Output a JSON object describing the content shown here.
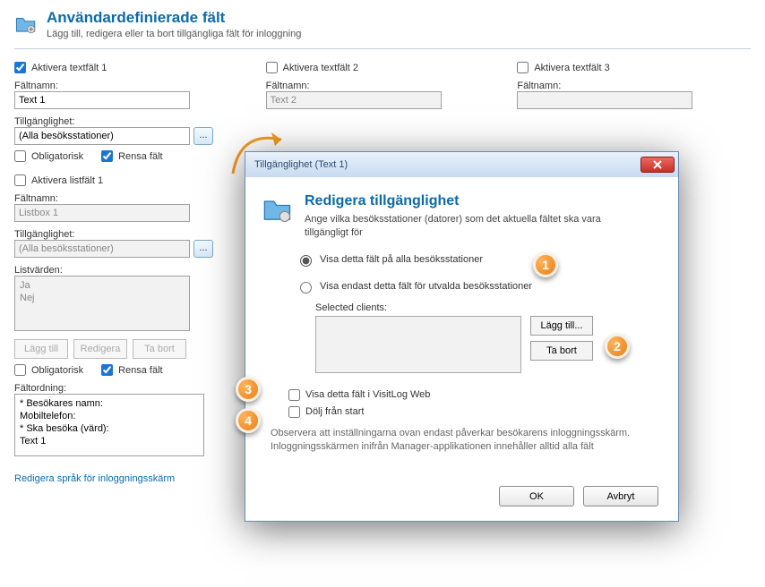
{
  "header": {
    "title": "Användardefinierade fält",
    "subtitle": "Lägg till, redigera eller ta bort tillgängliga fält för inloggning"
  },
  "textfields": [
    {
      "activate_label": "Aktivera textfält 1",
      "activate_checked": true,
      "name_label": "Fältnamn:",
      "name_value": "Text 1",
      "avail_label": "Tillgänglighet:",
      "avail_value": "(Alla besöksstationer)",
      "mandatory_label": "Obligatorisk",
      "mandatory_checked": false,
      "clear_label": "Rensa fält",
      "clear_checked": true
    },
    {
      "activate_label": "Aktivera textfält 2",
      "activate_checked": false,
      "name_label": "Fältnamn:",
      "name_value": "Text 2"
    },
    {
      "activate_label": "Aktivera textfält 3",
      "activate_checked": false,
      "name_label": "Fältnamn:",
      "name_value": ""
    }
  ],
  "listfield": {
    "activate_label": "Aktivera listfält 1",
    "activate_checked": false,
    "name_label": "Fältnamn:",
    "name_value": "Listbox 1",
    "avail_label": "Tillgänglighet:",
    "avail_value": "(Alla besöksstationer)",
    "values_label": "Listvärden:",
    "values_text": "Ja\nNej",
    "add_btn": "Lägg till",
    "edit_btn": "Redigera",
    "remove_btn": "Ta bort",
    "mandatory_label": "Obligatorisk",
    "mandatory_checked": false,
    "clear_label": "Rensa fält",
    "clear_checked": true
  },
  "order": {
    "label": "Fältordning:",
    "text": "* Besökares namn:\nMobiltelefon:\n* Ska besöka (värd):\nText 1"
  },
  "bottom_link": "Redigera språk för inloggningsskärm",
  "modal": {
    "title": "Tillgänglighet (Text 1)",
    "heading": "Redigera tillgänglighet",
    "desc": "Ange vilka besöksstationer (datorer) som det aktuella fältet ska vara tillgängligt för",
    "radio_all": "Visa detta fält på alla besöksstationer",
    "radio_selected_only": "Visa endast detta fält för utvalda besöksstationer",
    "selected_clients_label": "Selected clients:",
    "add_btn": "Lägg till...",
    "remove_btn": "Ta bort",
    "show_web_label": "Visa detta fält i VisitLog Web",
    "show_web_checked": false,
    "hide_start_label": "Dölj från start",
    "hide_start_checked": false,
    "note": "Observera att inställningarna ovan endast påverkar besökarens inloggningsskärm. Inloggningsskärmen inifrån Manager-applikationen innehåller alltid alla fält",
    "ok_btn": "OK",
    "cancel_btn": "Avbryt"
  },
  "badges": {
    "1": "1",
    "2": "2",
    "3": "3",
    "4": "4"
  }
}
